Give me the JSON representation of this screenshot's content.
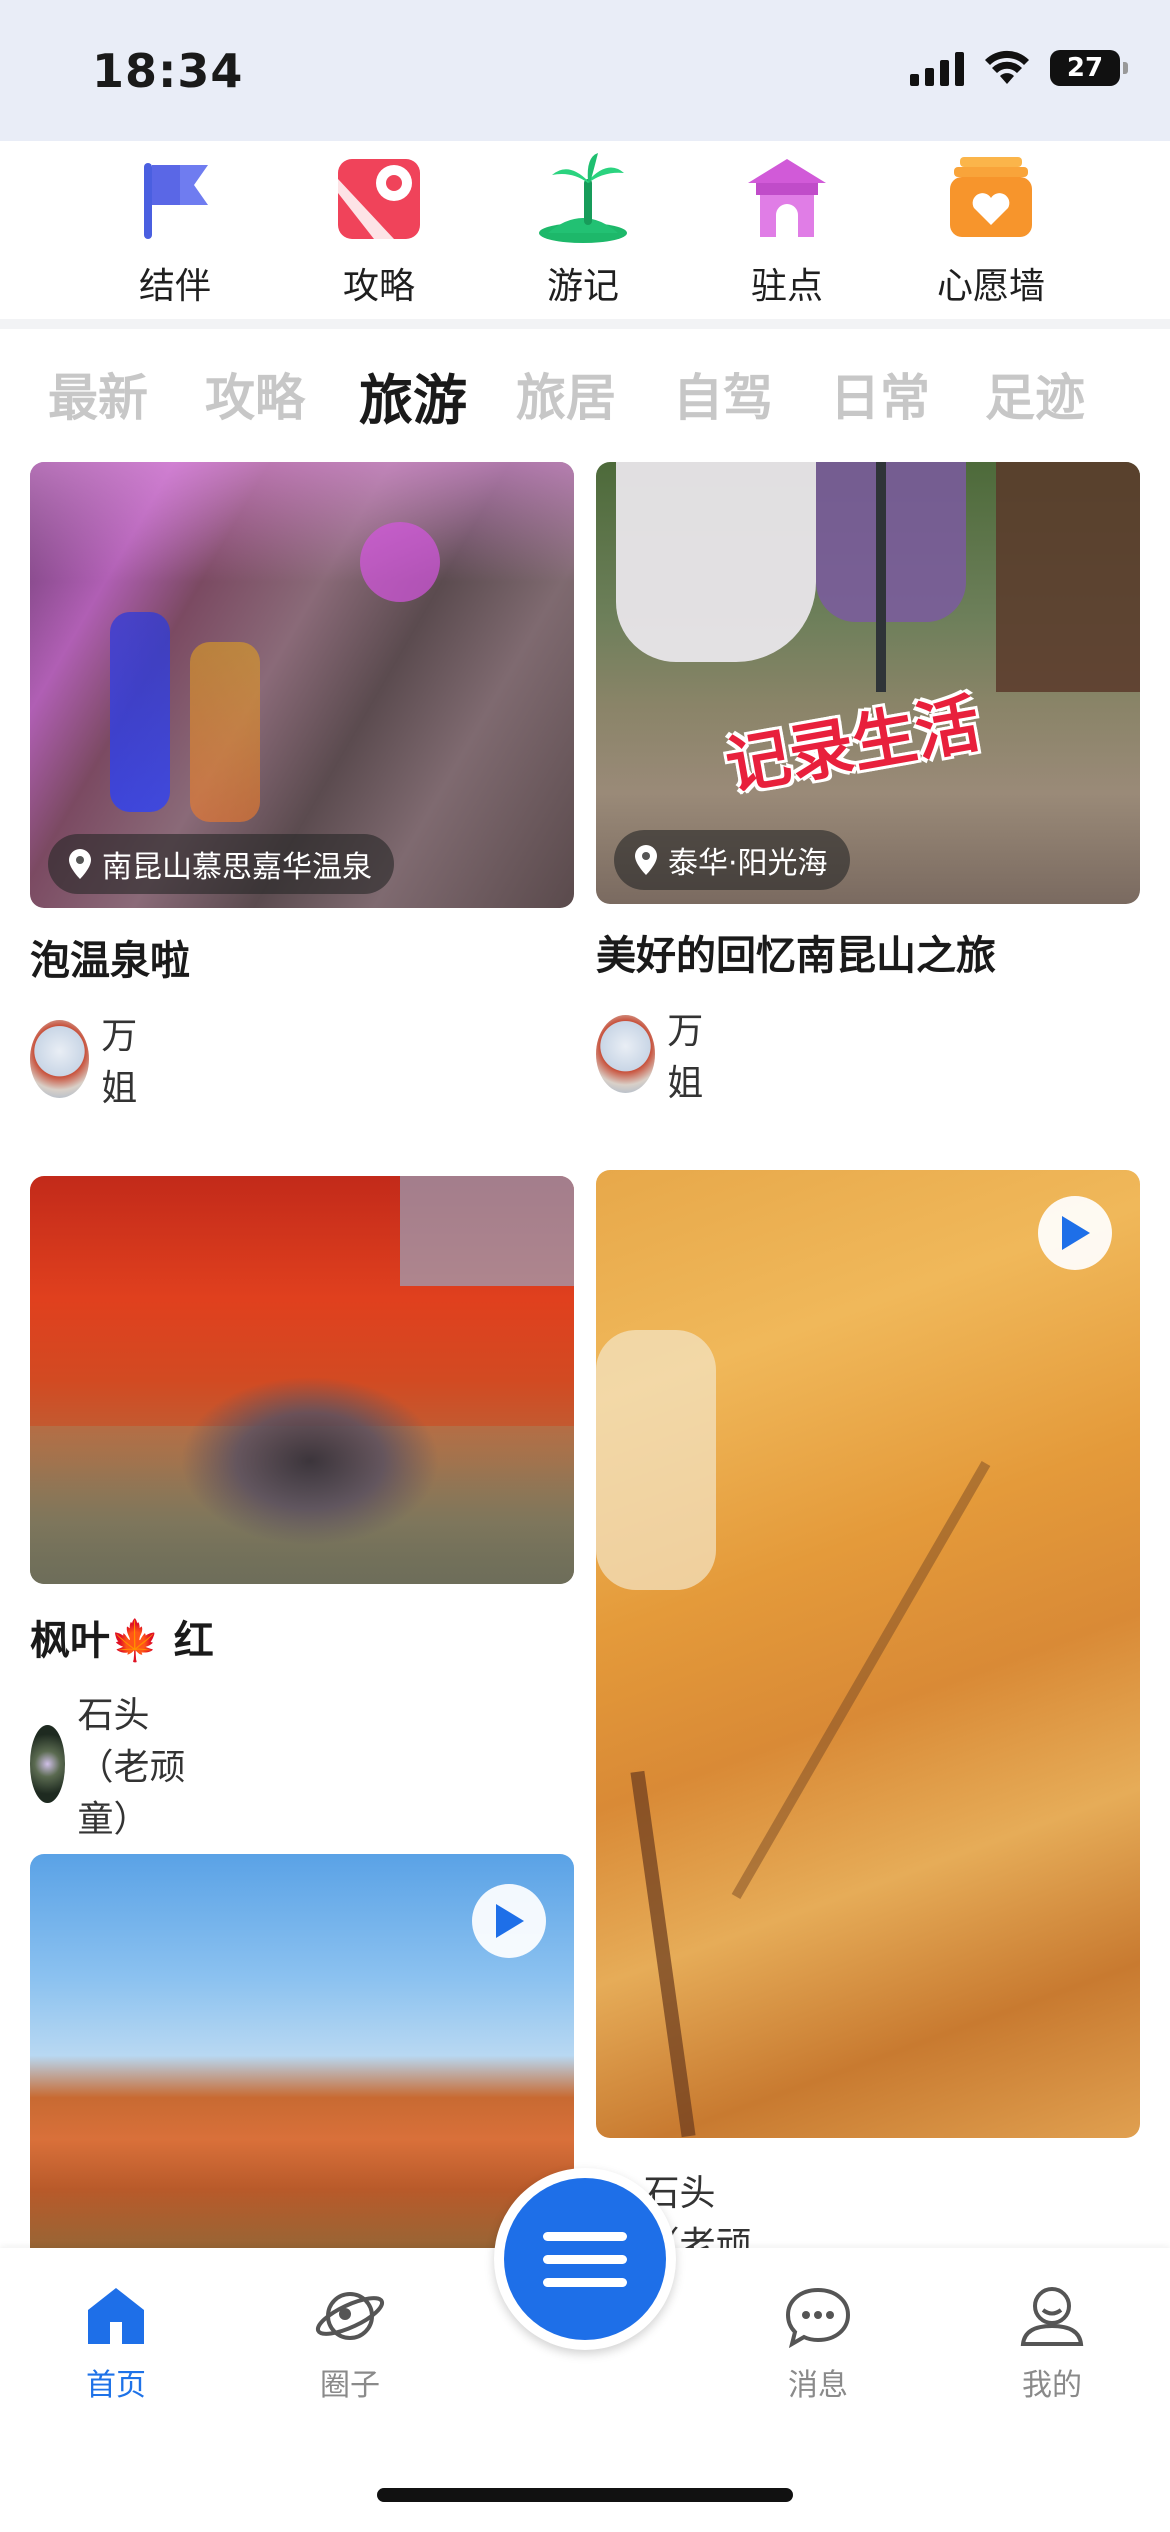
{
  "status": {
    "time": "18:34",
    "battery": "27"
  },
  "quick_nav": [
    {
      "label": "结伴",
      "icon": "flag-icon"
    },
    {
      "label": "攻略",
      "icon": "map-pin-icon"
    },
    {
      "label": "游记",
      "icon": "palm-island-icon"
    },
    {
      "label": "驻点",
      "icon": "pavilion-icon"
    },
    {
      "label": "心愿墙",
      "icon": "heart-box-icon"
    }
  ],
  "tabs": [
    "最新",
    "攻略",
    "旅游",
    "旅居",
    "自驾",
    "日常",
    "足迹"
  ],
  "active_tab": "旅游",
  "cards": [
    {
      "title": "泡温泉啦",
      "location": "南昆山慕思嘉华温泉",
      "author": "万姐",
      "video": false
    },
    {
      "title": "美好的回忆南昆山之旅",
      "location": "泰华·阳光海",
      "author": "万姐",
      "video": false,
      "overlay_text": "记录生活"
    },
    {
      "title": "枫叶🍁 红",
      "author": "石头（老顽童）",
      "video": false
    },
    {
      "title": "",
      "author": "石头（老顽童）",
      "video": true
    },
    {
      "title": "",
      "author": "",
      "video": true
    }
  ],
  "tabbar": [
    {
      "label": "首页",
      "icon": "home-icon",
      "active": true
    },
    {
      "label": "圈子",
      "icon": "planet-icon",
      "active": false
    },
    {
      "label": "消息",
      "icon": "chat-bubble-icon",
      "active": false
    },
    {
      "label": "我的",
      "icon": "user-icon",
      "active": false
    }
  ],
  "colors": {
    "accent": "#1e6fe8",
    "status_bg": "#e9edf7"
  }
}
